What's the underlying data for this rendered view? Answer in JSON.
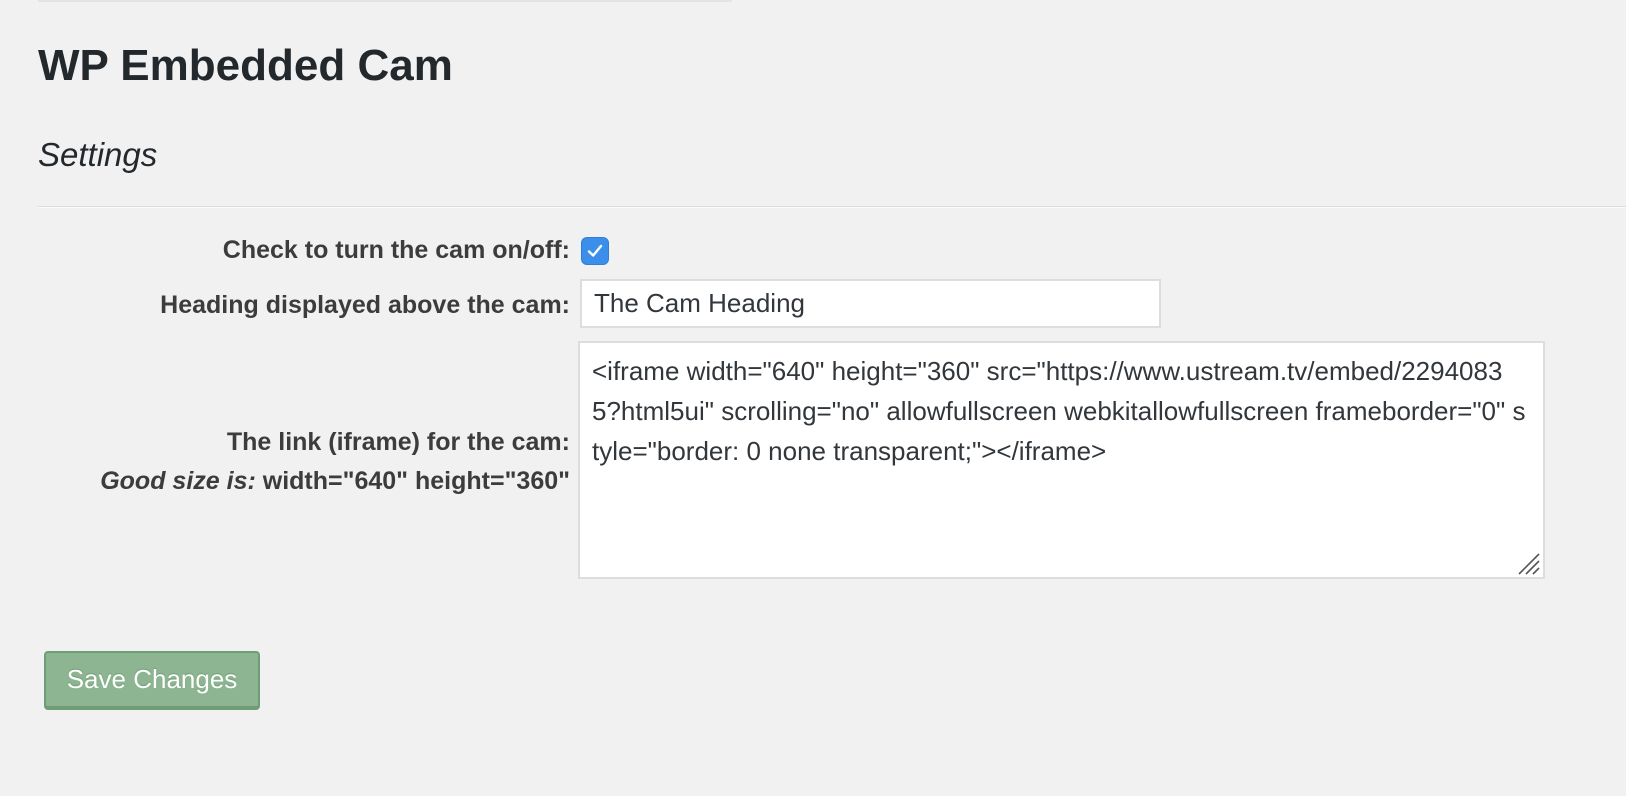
{
  "page": {
    "title": "WP Embedded Cam",
    "section": "Settings"
  },
  "settings": {
    "cam_toggle": {
      "label": "Check to turn the cam on/off:",
      "checked": true
    },
    "heading": {
      "label": "Heading displayed above the cam:",
      "value": "The Cam Heading"
    },
    "iframe": {
      "label": "The link (iframe) for the cam:",
      "hint_emphasis": "Good size is:",
      "hint_text": " width=\"640\" height=\"360\"",
      "value": "<iframe width=\"640\" height=\"360\" src=\"https://www.ustream.tv/embed/22940835?html5ui\" scrolling=\"no\" allowfullscreen webkitallowfullscreen frameborder=\"0\" style=\"border: 0 none transparent;\"></iframe>"
    }
  },
  "actions": {
    "save_label": "Save Changes"
  },
  "colors": {
    "background": "#f1f1f1",
    "checkbox_accent": "#3b8fea",
    "save_button": "#8db592"
  },
  "icons": {
    "checkbox": "check-icon",
    "resize": "resize-grip-icon"
  }
}
